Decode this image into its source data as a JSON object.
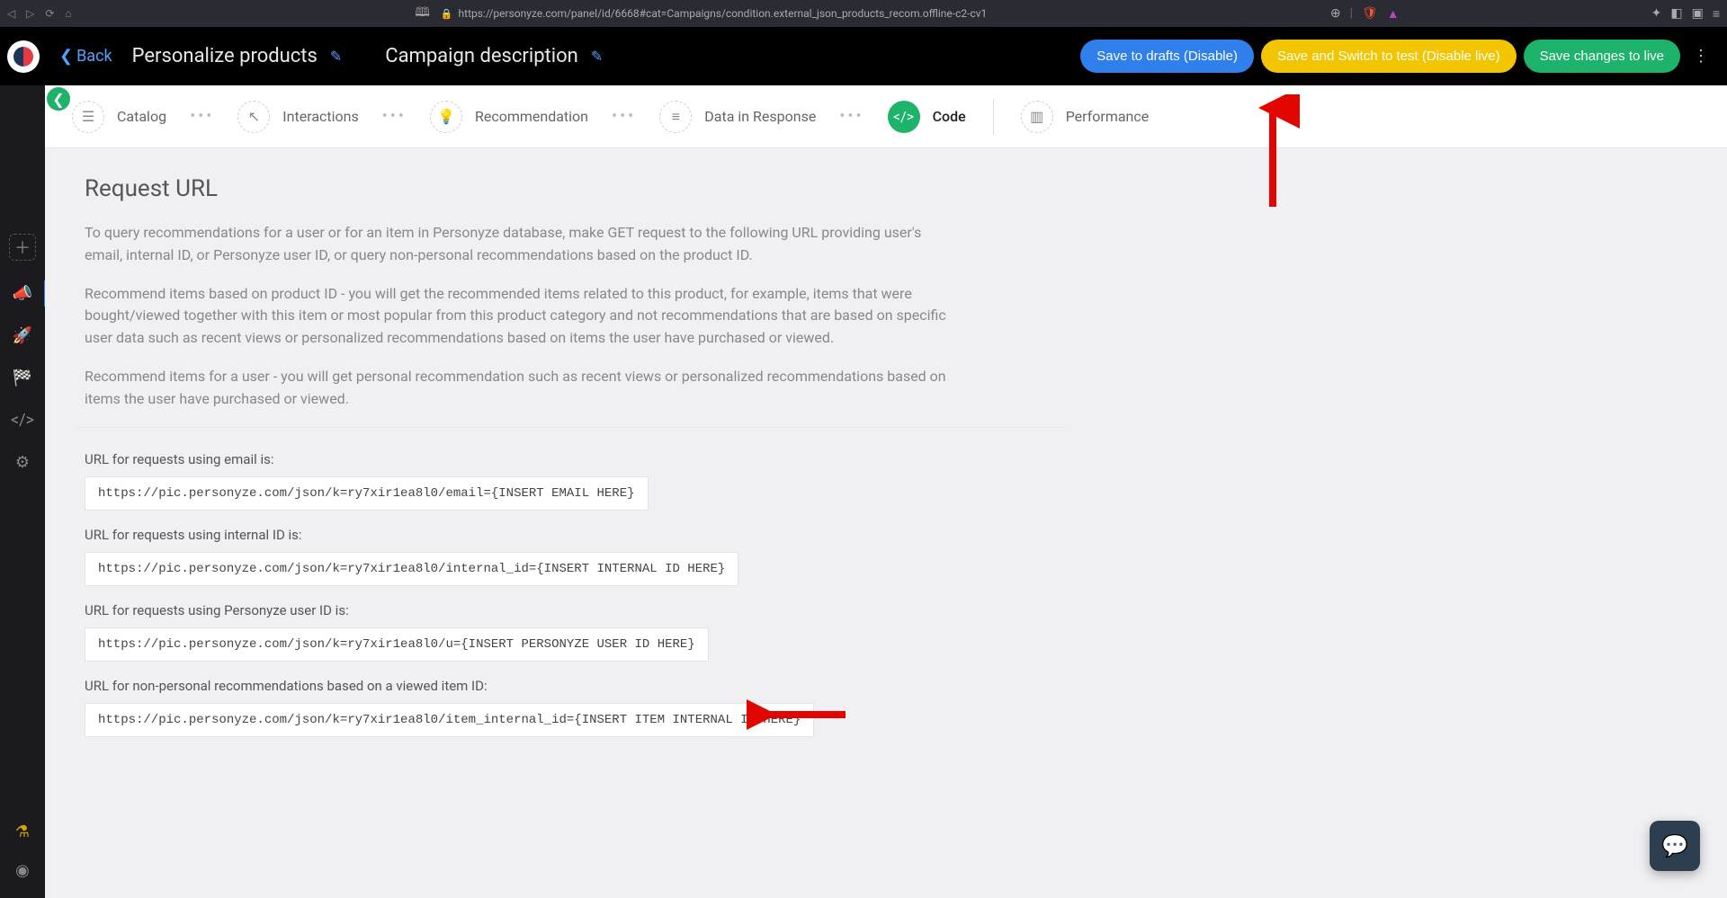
{
  "browser": {
    "url_display": "https://personyze.com/panel/id/6668#cat=Campaigns/condition.external_json_products_recom.offline-c2-cv1",
    "url_bold": "personyze.com"
  },
  "header": {
    "back_label": "Back",
    "title": "Personalize products",
    "subtitle": "Campaign description",
    "buttons": {
      "save_drafts": "Save to drafts (Disable)",
      "save_switch": "Save and Switch to test (Disable live)",
      "save_live": "Save changes to live"
    }
  },
  "stepper": {
    "catalog": "Catalog",
    "interactions": "Interactions",
    "recommendation": "Recommendation",
    "data_response": "Data in Response",
    "code": "Code",
    "performance": "Performance"
  },
  "content": {
    "heading": "Request URL",
    "p1": "To query recommendations for a user or for an item in Personyze database, make GET request to the following URL providing user's email, internal ID, or Personyze user ID, or query non-personal recommendations based on the product ID.",
    "p2": "Recommend items based on product ID - you will get the recommended items related to this product, for example, items that were bought/viewed together with this item or most popular from this product category and not recommendations that are based on specific user data such as recent views or personalized recommendations based on items the user have purchased or viewed.",
    "p3": "Recommend items for a user - you will get personal recommendation such as recent views or personalized recommendations based on items the user have purchased or viewed."
  },
  "urls": {
    "label_email": "URL for requests using email is:",
    "url_email": "https://pic.personyze.com/json/k=ry7xir1ea8l0/email={INSERT EMAIL HERE}",
    "label_internal": "URL for requests using internal ID is:",
    "url_internal": "https://pic.personyze.com/json/k=ry7xir1ea8l0/internal_id={INSERT INTERNAL ID HERE}",
    "label_personyze": "URL for requests using Personyze user ID is:",
    "url_personyze": "https://pic.personyze.com/json/k=ry7xir1ea8l0/u={INSERT PERSONYZE USER ID HERE}",
    "label_item": "URL for non-personal recommendations based on a viewed item ID:",
    "url_item": "https://pic.personyze.com/json/k=ry7xir1ea8l0/item_internal_id={INSERT ITEM INTERNAL ID HERE}"
  }
}
